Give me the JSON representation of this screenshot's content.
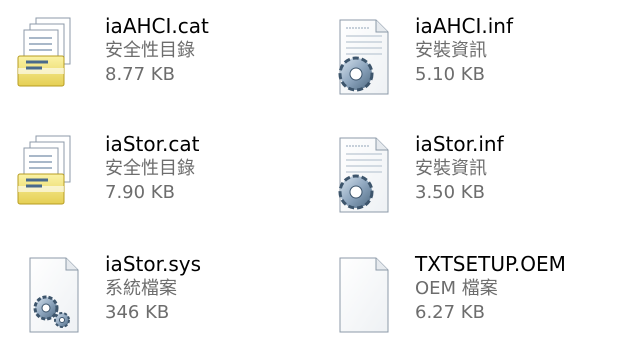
{
  "files": [
    {
      "name": "iaAHCI.cat",
      "type": "安全性目錄",
      "size": "8.77 KB",
      "icon": "security-catalog-icon"
    },
    {
      "name": "iaAHCI.inf",
      "type": "安裝資訊",
      "size": "5.10 KB",
      "icon": "setup-information-icon"
    },
    {
      "name": "iaStor.cat",
      "type": "安全性目錄",
      "size": "7.90 KB",
      "icon": "security-catalog-icon"
    },
    {
      "name": "iaStor.inf",
      "type": "安裝資訊",
      "size": "3.50 KB",
      "icon": "setup-information-icon"
    },
    {
      "name": "iaStor.sys",
      "type": "系統檔案",
      "size": "346 KB",
      "icon": "system-file-icon"
    },
    {
      "name": "TXTSETUP.OEM",
      "type": "OEM 檔案",
      "size": "6.27 KB",
      "icon": "blank-file-icon"
    }
  ],
  "colors": {
    "name_text": "#000000",
    "detail_text": "#6d6d6d",
    "background": "#ffffff"
  }
}
